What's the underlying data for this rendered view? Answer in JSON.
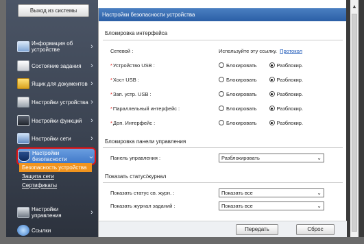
{
  "sidebar": {
    "logout_label": "Выход из системы",
    "items": [
      {
        "label": "Информация об устройстве",
        "icon": "info-icon"
      },
      {
        "label": "Состояние задания",
        "icon": "job-status-icon"
      },
      {
        "label": "Ящик для документов",
        "icon": "document-box-icon"
      },
      {
        "label": "Настройки устройства",
        "icon": "device-settings-icon"
      },
      {
        "label": "Настройки функций",
        "icon": "function-settings-icon"
      },
      {
        "label": "Настройки сети",
        "icon": "network-settings-icon"
      },
      {
        "label": "Настройки безопасности",
        "icon": "shield-icon"
      },
      {
        "label": "Настройки управления",
        "icon": "management-settings-icon"
      },
      {
        "label": "Ссылки",
        "icon": "links-icon"
      }
    ],
    "sub_links": [
      "Безопасность устройства",
      "Защита сети",
      "Сертификаты"
    ]
  },
  "panel": {
    "title": "Настройки безопасности устройства",
    "interface_block": {
      "title": "Блокировка интерфейса",
      "network_label": "Сетевой :",
      "network_value": "Используйте эту ссылку.",
      "network_link": "Протокол",
      "option_lock": "Блокировать",
      "option_unlock": "Разблокир.",
      "rows": [
        {
          "label": "Устройство USB :"
        },
        {
          "label": "Хост USB :"
        },
        {
          "label": "Зап. устр. USB :"
        },
        {
          "label": "Параллельный интерфейс :"
        },
        {
          "label": "Доп. Интерфейс :"
        }
      ]
    },
    "panel_lock": {
      "title": "Блокировка панели управления",
      "label": "Панель управления :",
      "value": "Разблокировать"
    },
    "log_status": {
      "title": "Показать статус/журнал",
      "rows": [
        {
          "label": "Показать статус св. журн. :",
          "value": "Показать все"
        },
        {
          "label": "Показать журнал заданий :",
          "value": "Показать все"
        }
      ]
    },
    "buttons": {
      "submit": "Передать",
      "reset": "Сброс"
    }
  },
  "colors": {
    "accent": "#2b5fa6",
    "selected_sub": "#f1941e",
    "highlight_border": "#e01010"
  }
}
